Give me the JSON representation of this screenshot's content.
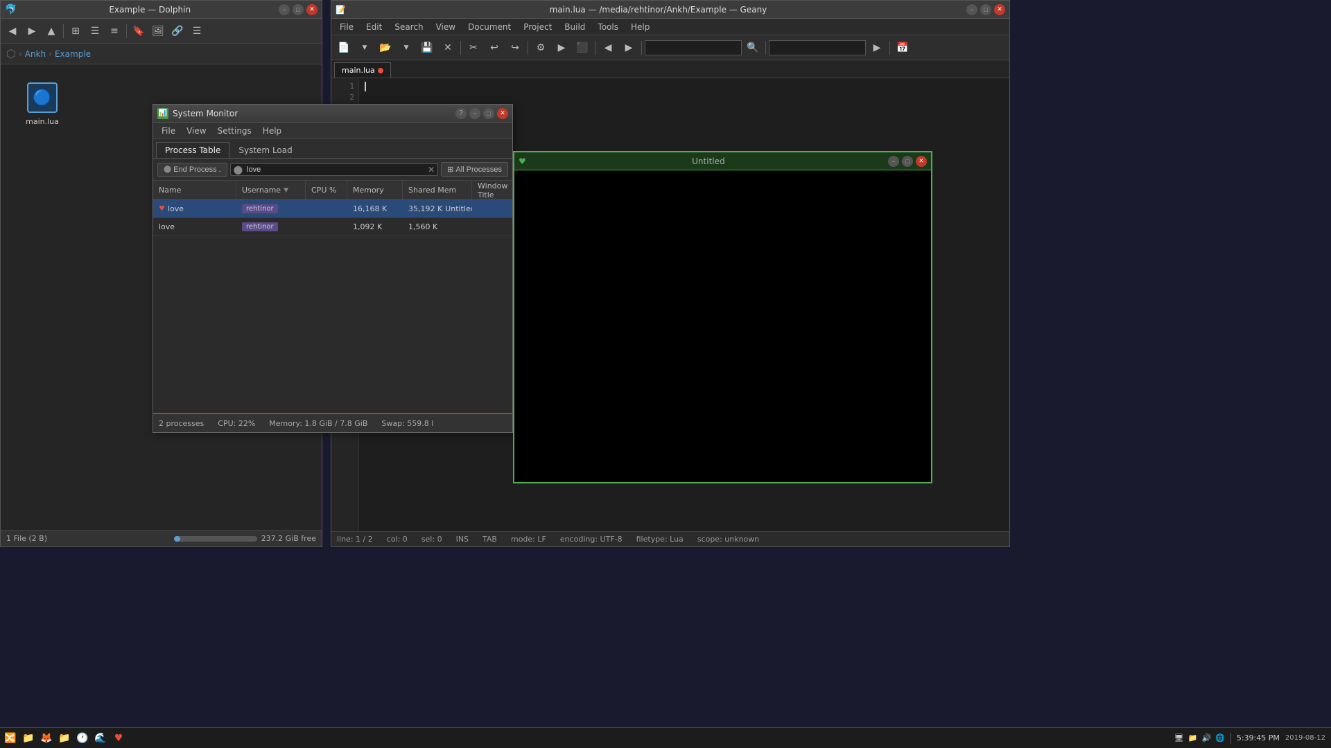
{
  "dolphin": {
    "title": "Example — Dolphin",
    "breadcrumb": {
      "root": "",
      "part1": "Ankh",
      "part2": "Example"
    },
    "file": {
      "name": "main.lua",
      "icon": "🔵"
    },
    "statusbar": {
      "file_count": "1 File (2 B)",
      "free_space": "237.2 GiB free"
    },
    "toolbar": {
      "back": "◀",
      "forward": "▶",
      "up": "▲",
      "grid_view": "⊞",
      "list_view": "☰",
      "compact_view": "⊟",
      "bookmark": "🔖",
      "preview": "🖼",
      "link": "🔗",
      "hamburger": "☰"
    }
  },
  "geany": {
    "title": "main.lua — /media/rehtinor/Ankh/Example — Geany",
    "menu": [
      "File",
      "Edit",
      "Search",
      "View",
      "Document",
      "Project",
      "Build",
      "Tools",
      "Help"
    ],
    "tab": {
      "label": "main.lua",
      "modified": true
    },
    "editor": {
      "line1": "",
      "line2": ""
    },
    "statusbar": {
      "line": "line: 1 / 2",
      "col": "col: 0",
      "sel": "sel: 0",
      "ins": "INS",
      "tab": "TAB",
      "mode": "mode: LF",
      "encoding": "encoding: UTF-8",
      "filetype": "filetype: Lua",
      "scope": "scope: unknown"
    }
  },
  "sysmon": {
    "title": "System Monitor",
    "tabs": [
      "Process Table",
      "System Load"
    ],
    "active_tab": "Process Table",
    "toolbar": {
      "end_process_label": "End Process .",
      "search_value": "love",
      "filter_label": "All Processes",
      "filter_icon": "⊞"
    },
    "table": {
      "columns": [
        "Name",
        "Username",
        "CPU %",
        "Memory",
        "Shared Mem",
        "Window Title"
      ],
      "rows": [
        {
          "name": "love",
          "has_heart": true,
          "username": "rehtinor",
          "cpu": "",
          "memory": "16,168 K",
          "shared_mem": "35,192 K",
          "window_title": "Untitled",
          "selected": true
        },
        {
          "name": "love",
          "has_heart": false,
          "username": "rehtinor",
          "cpu": "",
          "memory": "1,092 K",
          "shared_mem": "1,560 K",
          "window_title": "",
          "selected": false
        }
      ]
    },
    "statusbar": {
      "processes": "2 processes",
      "cpu": "CPU: 22%",
      "memory": "Memory: 1.8 GiB / 7.8 GiB",
      "swap": "Swap: 559.8 l"
    }
  },
  "untitled": {
    "title": "Untitled",
    "icon": "♥"
  },
  "taskbar": {
    "apps": [
      "🔀",
      "📁",
      "🦊",
      "📁",
      "🕐",
      "🌊",
      "♥"
    ],
    "time": "5:39:45 PM",
    "date": "2019-08-12",
    "tray_icons": [
      "🖥",
      "📁",
      "🔊",
      "🌐"
    ]
  }
}
